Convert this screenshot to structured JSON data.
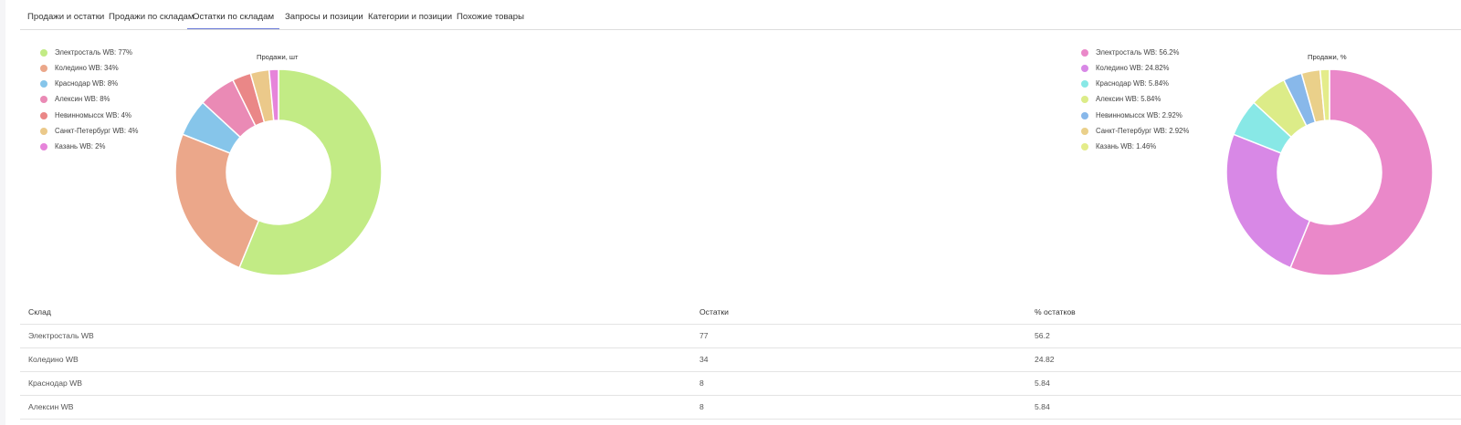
{
  "tabs": [
    {
      "label": "Продажи и остатки"
    },
    {
      "label": "Продажи по складам"
    },
    {
      "label": "Остатки по складам",
      "active": true
    },
    {
      "label": "Запросы и позиции"
    },
    {
      "label": "Категории и позиции"
    },
    {
      "label": "Похожие товары"
    }
  ],
  "left_chart": {
    "title": "Продажи, шт",
    "legend": [
      {
        "label": "Электросталь WB: 77%",
        "color": "#c2eb85"
      },
      {
        "label": "Коледино WB: 34%",
        "color": "#eba78a"
      },
      {
        "label": "Краснодар WB: 8%",
        "color": "#86c5ea"
      },
      {
        "label": "Алексин WB: 8%",
        "color": "#ea8ab5"
      },
      {
        "label": "Невинномысск WB: 4%",
        "color": "#ea8787"
      },
      {
        "label": "Санкт-Петербург WB: 4%",
        "color": "#ebc98a"
      },
      {
        "label": "Казань WB: 2%",
        "color": "#e684da"
      }
    ]
  },
  "right_chart": {
    "title": "Продажи, %",
    "legend": [
      {
        "label": "Электросталь WB: 56.2%",
        "color": "#ea88c9"
      },
      {
        "label": "Коледино WB: 24.82%",
        "color": "#d888e6"
      },
      {
        "label": "Краснодар WB: 5.84%",
        "color": "#88e8e6"
      },
      {
        "label": "Алексин WB: 5.84%",
        "color": "#dcec88"
      },
      {
        "label": "Невинномысск WB: 2.92%",
        "color": "#88b8ea"
      },
      {
        "label": "Санкт-Петербург WB: 2.92%",
        "color": "#ead08a"
      },
      {
        "label": "Казань WB: 1.46%",
        "color": "#e4ec8a"
      }
    ]
  },
  "chart_data": [
    {
      "type": "pie",
      "title": "Продажи, шт",
      "categories": [
        "Электросталь WB",
        "Коледино WB",
        "Краснодар WB",
        "Алексин WB",
        "Невинномысск WB",
        "Санкт-Петербург WB",
        "Казань WB"
      ],
      "values": [
        77,
        34,
        8,
        8,
        4,
        4,
        2
      ],
      "legend_position": "left"
    },
    {
      "type": "pie",
      "title": "Продажи, %",
      "categories": [
        "Электросталь WB",
        "Коледино WB",
        "Краснодар WB",
        "Алексин WB",
        "Невинномысск WB",
        "Санкт-Петербург WB",
        "Казань WB"
      ],
      "values": [
        56.2,
        24.82,
        5.84,
        5.84,
        2.92,
        2.92,
        1.46
      ],
      "legend_position": "left"
    }
  ],
  "table": {
    "headers": [
      "Склад",
      "Остатки",
      "% остатков"
    ],
    "rows": [
      [
        "Электросталь WB",
        "77",
        "56.2"
      ],
      [
        "Коледино WB",
        "34",
        "24.82"
      ],
      [
        "Краснодар WB",
        "8",
        "5.84"
      ],
      [
        "Алексин WB",
        "8",
        "5.84"
      ]
    ]
  }
}
